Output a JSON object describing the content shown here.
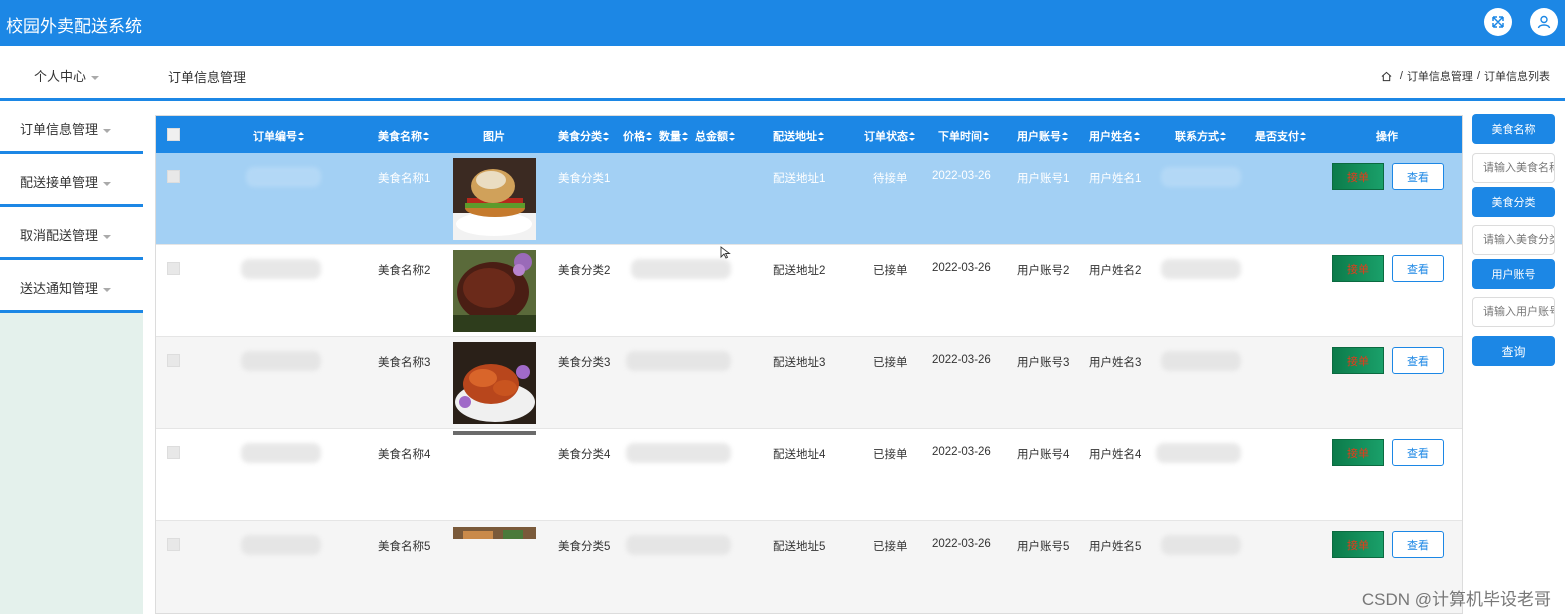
{
  "app": {
    "title": "校园外卖配送系统"
  },
  "nav": {
    "user_center": "个人中心",
    "page_title": "订单信息管理"
  },
  "breadcrumb": {
    "items": [
      "订单信息管理",
      "订单信息列表"
    ]
  },
  "sidebar": {
    "items": [
      {
        "label": "订单信息管理"
      },
      {
        "label": "配送接单管理"
      },
      {
        "label": "取消配送管理"
      },
      {
        "label": "送达通知管理"
      }
    ]
  },
  "table": {
    "headers": [
      "订单编号",
      "美食名称",
      "图片",
      "美食分类",
      "价格",
      "数量",
      "总金额",
      "配送地址",
      "订单状态",
      "下单时间",
      "用户账号",
      "用户姓名",
      "联系方式",
      "是否支付",
      "操作"
    ],
    "rows": [
      {
        "food": "美食名称1",
        "category": "美食分类1",
        "address": "配送地址1",
        "status": "待接单",
        "time": "2022-03-26",
        "account": "用户账号1",
        "name": "用户姓名1"
      },
      {
        "food": "美食名称2",
        "category": "美食分类2",
        "address": "配送地址2",
        "status": "已接单",
        "time": "2022-03-26",
        "account": "用户账号2",
        "name": "用户姓名2"
      },
      {
        "food": "美食名称3",
        "category": "美食分类3",
        "address": "配送地址3",
        "status": "已接单",
        "time": "2022-03-26",
        "account": "用户账号3",
        "name": "用户姓名3"
      },
      {
        "food": "美食名称4",
        "category": "美食分类4",
        "address": "配送地址4",
        "status": "已接单",
        "time": "2022-03-26",
        "account": "用户账号4",
        "name": "用户姓名4"
      },
      {
        "food": "美食名称5",
        "category": "美食分类5",
        "address": "配送地址5",
        "status": "已接单",
        "time": "2022-03-26",
        "account": "用户账号5",
        "name": "用户姓名5"
      }
    ],
    "accept_label": "接单",
    "view_label": "查看"
  },
  "search": {
    "food_label": "美食名称",
    "food_placeholder": "请输入美食名称",
    "category_label": "美食分类",
    "category_placeholder": "请输入美食分类",
    "account_label": "用户账号",
    "account_placeholder": "请输入用户账号",
    "query_label": "查询"
  },
  "watermark": "CSDN @计算机毕设老哥",
  "colors": {
    "primary": "#1c87e5",
    "selected_row": "#a3d0f4",
    "accept": "#0c7b4a",
    "sidebar_bg": "#e4f1ec"
  }
}
